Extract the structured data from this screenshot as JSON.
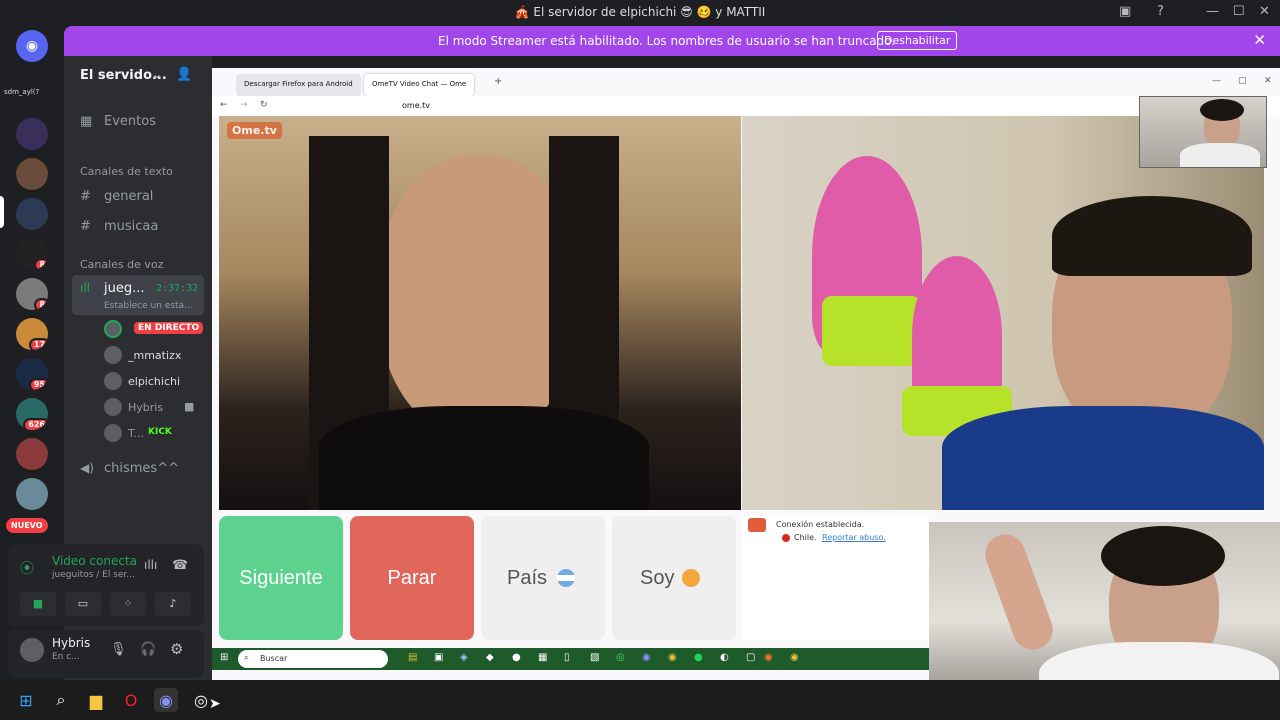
{
  "window": {
    "title": "🎪 El servidor de elpichichi 😎 🥴 y MATTII"
  },
  "banner": {
    "message": "El modo Streamer está habilitado. Los nombres de usuario se han truncado.",
    "button": "Deshabilitar"
  },
  "rail": {
    "top_label": "sdm_ayl(?",
    "new_label": "NUEVO",
    "badges": [
      "8",
      "8",
      "17",
      "95",
      "626"
    ]
  },
  "sidebar": {
    "server_name": "El servido...",
    "events": "Eventos",
    "text_category": "Canales de texto",
    "text_channels": [
      "general",
      "musicaa"
    ],
    "voice_category": "Canales de voz",
    "voice_channel": {
      "name": "jueg...",
      "timer": "2:37:32",
      "status": "Establece un esta..."
    },
    "live_badge": "EN DIRECTO",
    "users": [
      "_mmatizx",
      "elpichichi",
      "Hybris",
      "T..."
    ],
    "kick_label": "KICK",
    "other_voice": "chismes^^"
  },
  "voice_panel": {
    "status": "Video conecta",
    "sub": "jueguitos / El ser..."
  },
  "user_panel": {
    "name": "Hybris",
    "status": "En c..."
  },
  "browser": {
    "tabs": [
      "Descargar Firefox para Android",
      "OmeTV Video Chat — Ome"
    ],
    "url": "ome.tv",
    "logo": "Ome.tv"
  },
  "ome": {
    "next": "Siguiente",
    "stop": "Parar",
    "country": "País",
    "me": "Soy",
    "connected": "Conexión establecida.",
    "country_name": "Chile.",
    "report": "Reportar abuso."
  },
  "inner_taskbar": {
    "search": "Buscar"
  },
  "colors": {
    "banner": "#a146ea",
    "next_btn": "#5dd28f",
    "stop_btn": "#e0675a",
    "live": "#f23f43"
  }
}
